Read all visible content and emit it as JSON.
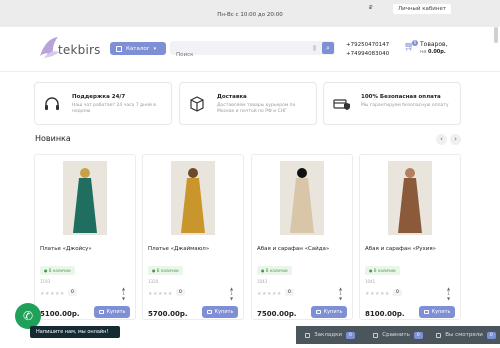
{
  "topbar": {
    "hours": "Пн-Вс с 10:00 до 20:00",
    "currency": "₽",
    "cabinet": "Личный кабинет"
  },
  "logo": {
    "text": "tekbirs"
  },
  "header": {
    "catalog": "Каталог",
    "search_placeholder": "Поиск",
    "phone1": "+79250470147",
    "phone2": "+74994083040",
    "cart_title": "Товаров,",
    "cart_prefix": "на",
    "cart_sum": "0.00р.",
    "cart_count": "0"
  },
  "features": [
    {
      "title": "Поддержка 24/7",
      "desc": "Наш чат работает 24 часа 7 дней в неделю",
      "icon": "headset-icon"
    },
    {
      "title": "Доставка",
      "desc": "Доставляем товары курьером по Москве и почтой по РФ и СНГ",
      "icon": "box-icon"
    },
    {
      "title": "100% Безопасная оплата",
      "desc": "Мы гарантируем безопасную оплату",
      "icon": "card-shield-icon"
    }
  ],
  "section": {
    "title": "Новинка",
    "prev": "‹",
    "next": "›"
  },
  "products": [
    {
      "name": "Платье «Джойсу»",
      "stock": "В наличии",
      "sku": "1193",
      "rating": "0",
      "price": "5100.00р.",
      "buy": "Купить",
      "color": "#1f6e60",
      "accent": "#c8a24a"
    },
    {
      "name": "Платье «Джаймаюл»",
      "stock": "В наличии",
      "sku": "1320",
      "rating": "0",
      "price": "5700.00р.",
      "buy": "Купить",
      "color": "#c8962a",
      "accent": "#6a4a28"
    },
    {
      "name": "Абая и сарафан «Сайда»",
      "stock": "В наличии",
      "sku": "1043",
      "rating": "0",
      "price": "7500.00р.",
      "buy": "Купить",
      "color": "#d9c6a8",
      "accent": "#111111"
    },
    {
      "name": "Абая и сарафан «Рухия»",
      "stock": "В наличии",
      "sku": "1041",
      "rating": "0",
      "price": "8100.00р.",
      "buy": "Купить",
      "color": "#8a5a3a",
      "accent": "#b08060"
    }
  ],
  "chat": {
    "text": "Напишите нам, мы онлайн!"
  },
  "bottombar": {
    "fav": "Закладки",
    "fav_count": "0",
    "compare": "Сравнить",
    "compare_count": "0",
    "viewed": "Вы смотрели",
    "viewed_count": "0"
  }
}
